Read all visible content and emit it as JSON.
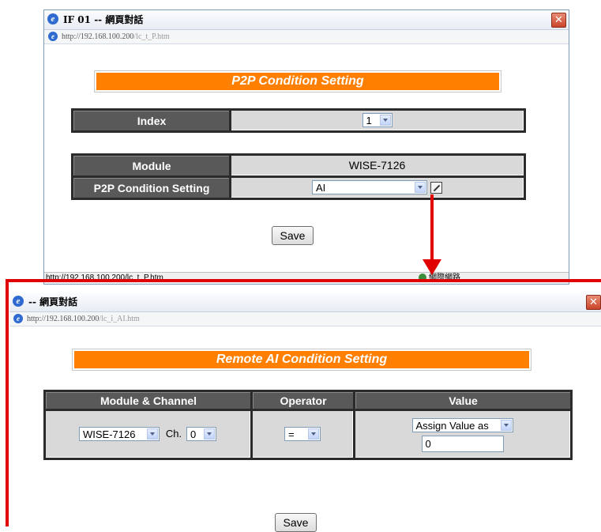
{
  "top_dialog": {
    "title": "IF 01 -- 網頁對話",
    "url_host": "http://192.168.100.200",
    "url_path": "/lc_t_P.htm",
    "heading": "P2P Condition Setting",
    "index_label": "Index",
    "index_value": "1",
    "module_label": "Module",
    "module_value": "WISE-7126",
    "condition_label": "P2P Condition Setting",
    "condition_value": "AI",
    "save_label": "Save",
    "status_url": "http://192.168.100.200/lc_t_P.htm",
    "status_zone": "網際網路"
  },
  "bottom_dialog": {
    "title": "-- 網頁對話",
    "url_host": "http://192.168.100.200",
    "url_path": "/lc_i_AI.htm",
    "heading": "Remote AI Condition Setting",
    "columns": [
      "Module & Channel",
      "Operator",
      "Value"
    ],
    "module_value": "WISE-7126",
    "channel_label": "Ch.",
    "channel_value": "0",
    "operator_value": "=",
    "value_mode": "Assign Value as",
    "value_input": "0",
    "save_label": "Save"
  },
  "colors": {
    "heading_orange": "#ff7f00",
    "table_header": "#595959",
    "table_cell": "#d9d9d9",
    "annotation_red": "#e00000"
  }
}
